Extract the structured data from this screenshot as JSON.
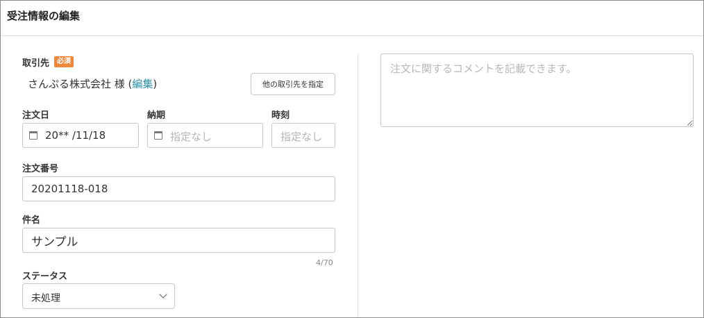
{
  "header": {
    "title": "受注情報の編集"
  },
  "client": {
    "label": "取引先",
    "required_badge": "必須",
    "name": "さんぷる株式会社 様 (",
    "edit_link": "編集",
    "name_suffix": ")",
    "change_button": "他の取引先を指定"
  },
  "order_date": {
    "label": "注文日",
    "value": "20** /11/18",
    "icon": "calendar-icon"
  },
  "delivery_date": {
    "label": "納期",
    "placeholder": "指定なし",
    "icon": "calendar-icon"
  },
  "time": {
    "label": "時刻",
    "placeholder": "指定なし"
  },
  "order_number": {
    "label": "注文番号",
    "value": "20201118-018"
  },
  "subject": {
    "label": "件名",
    "value": "サンプル",
    "counter": "4/70"
  },
  "status": {
    "label": "ステータス",
    "selected": "未処理",
    "icon": "chevron-down-icon"
  },
  "comment": {
    "placeholder": "注文に関するコメントを記載できます。"
  }
}
